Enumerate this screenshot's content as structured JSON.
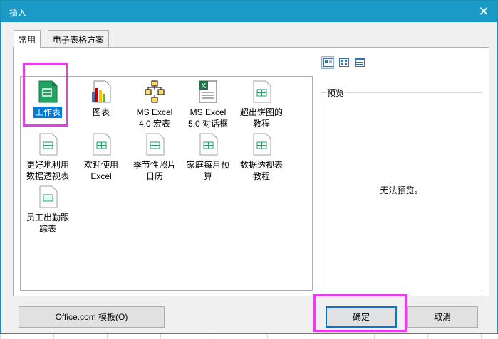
{
  "dialog": {
    "title": "插入",
    "close_glyph": "✕",
    "tabs": [
      {
        "label": "常用"
      },
      {
        "label": "电子表格方案"
      }
    ],
    "items": [
      {
        "label": "工作表",
        "icon": "worksheet-icon"
      },
      {
        "label": "图表",
        "icon": "chart-icon"
      },
      {
        "label": "MS Excel 4.0 宏表",
        "icon": "macro-sheet-icon"
      },
      {
        "label": "MS Excel 5.0 对话框",
        "icon": "dialog-sheet-icon"
      },
      {
        "label": "超出饼图的教程",
        "icon": "template-icon"
      },
      {
        "label": "更好地利用数据透视表",
        "icon": "template-icon"
      },
      {
        "label": "欢迎使用 Excel",
        "icon": "template-icon"
      },
      {
        "label": "季节性照片日历",
        "icon": "template-icon"
      },
      {
        "label": "家庭每月预算",
        "icon": "template-icon"
      },
      {
        "label": "数据透视表教程",
        "icon": "template-icon"
      },
      {
        "label": "员工出勤跟踪表",
        "icon": "template-icon"
      }
    ],
    "preview": {
      "legend": "预览",
      "message": "无法预览。"
    },
    "buttons": {
      "office_templates": "Office.com 模板(O)",
      "ok": "确定",
      "cancel": "取消"
    }
  },
  "colors": {
    "titlebar": "#1a9bc7",
    "highlight": "#e83ee8",
    "selection": "#0078d7"
  }
}
